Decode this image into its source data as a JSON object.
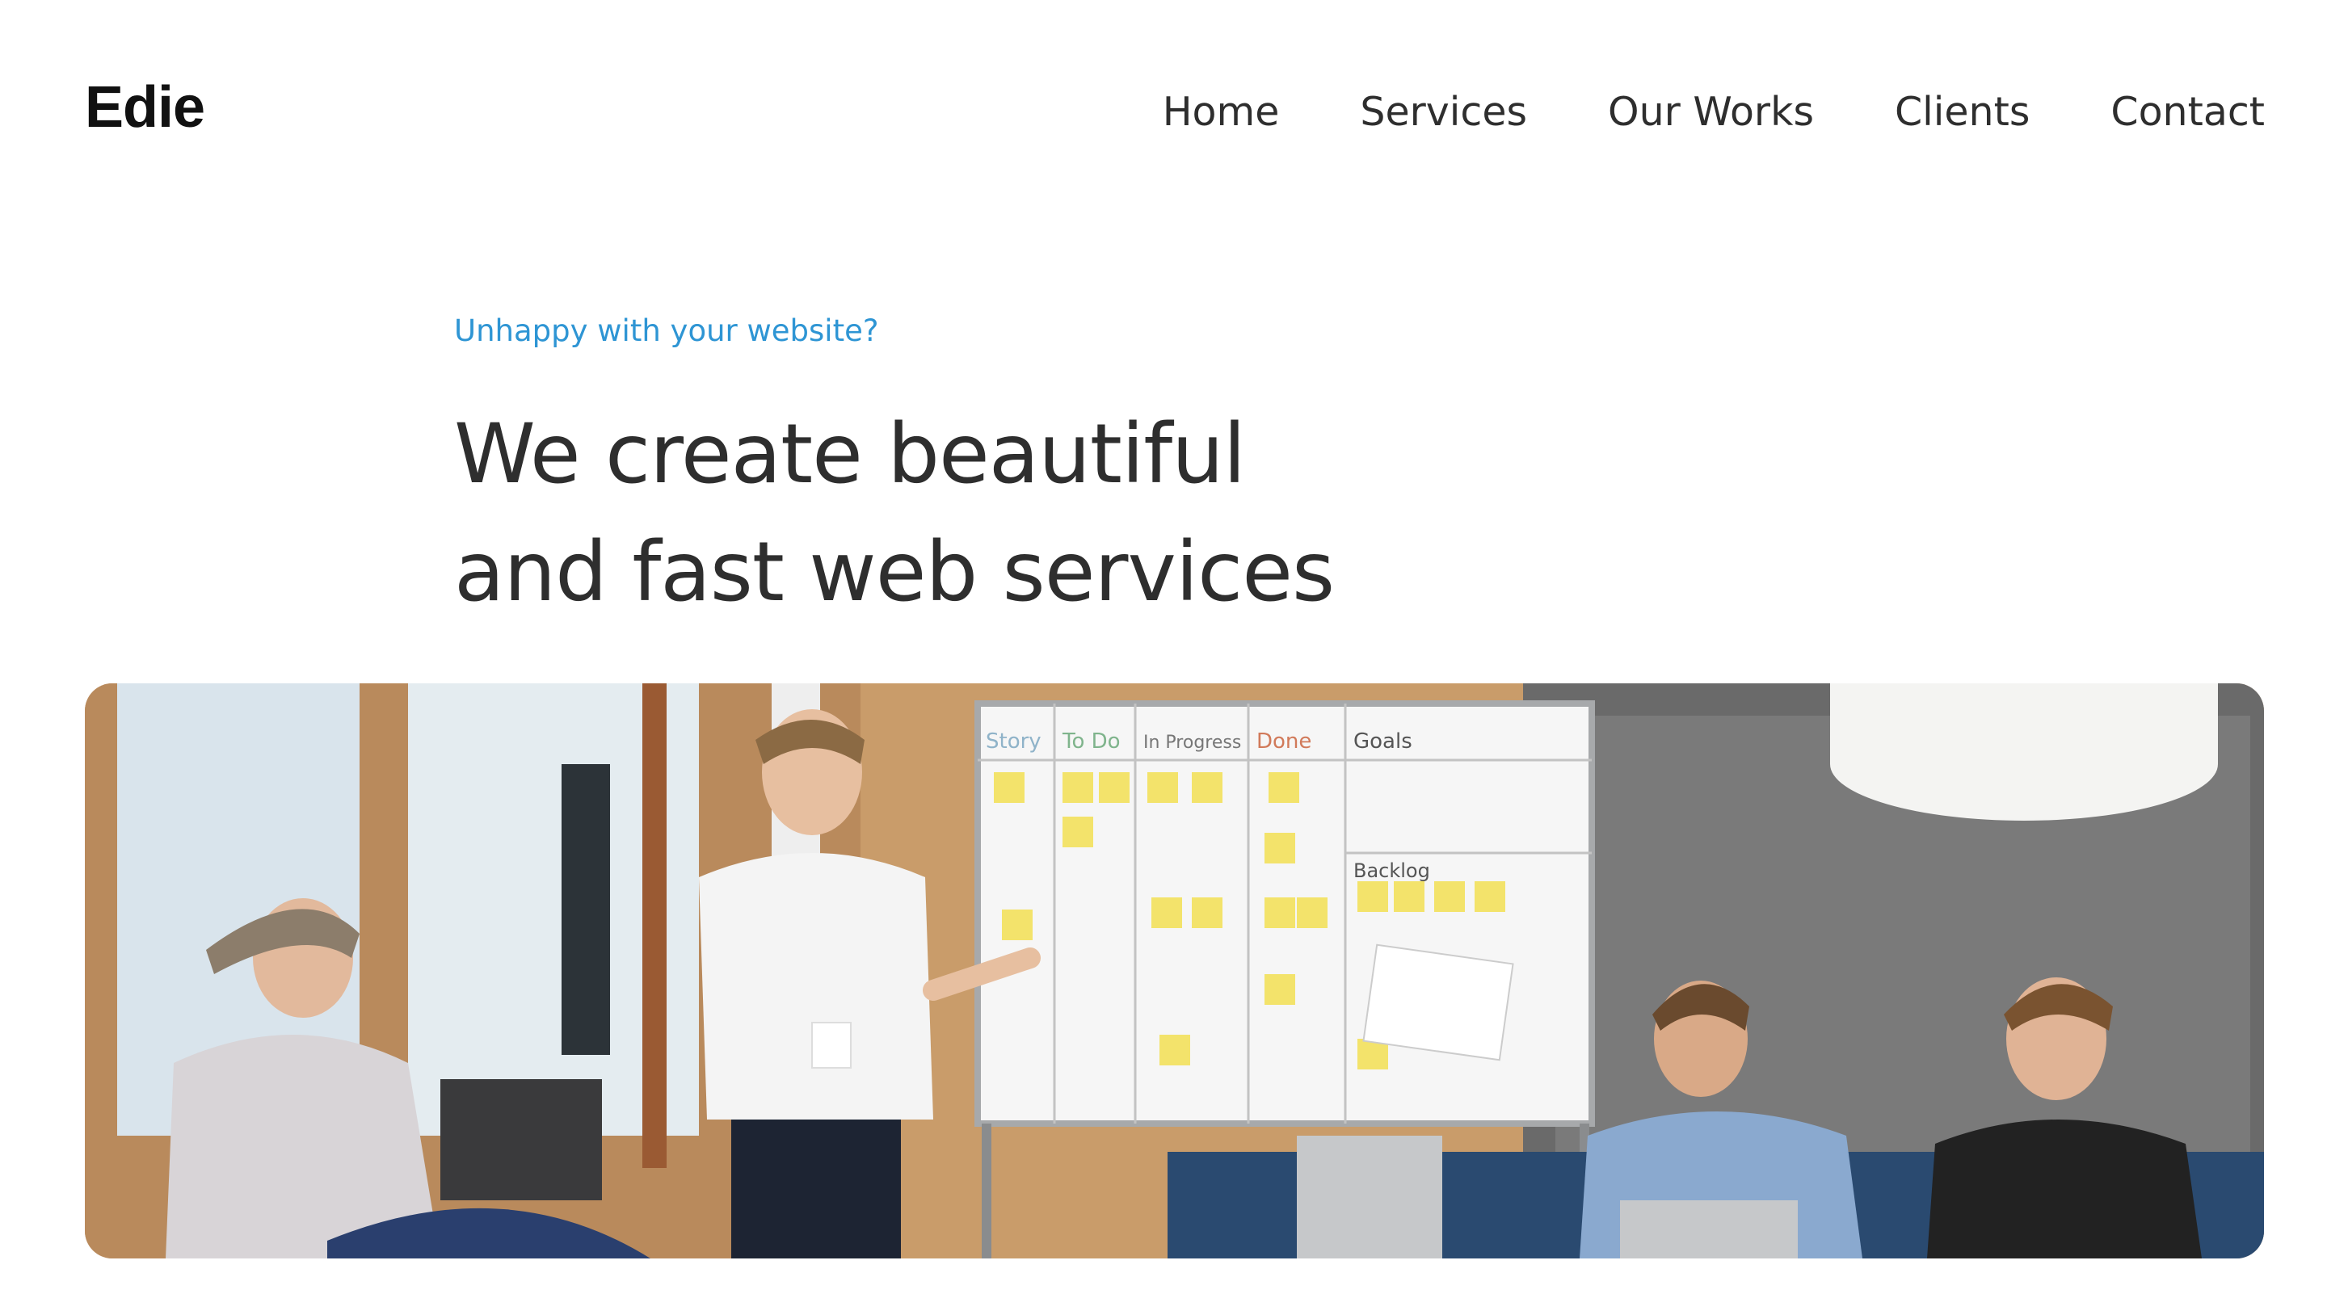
{
  "header": {
    "logo": "Edie",
    "nav": [
      {
        "label": "Home"
      },
      {
        "label": "Services"
      },
      {
        "label": "Our Works"
      },
      {
        "label": "Clients"
      },
      {
        "label": "Contact"
      }
    ]
  },
  "hero": {
    "eyebrow": "Unhappy with your website?",
    "headline_line1": "We create beautiful",
    "headline_line2": "and fast web services"
  },
  "board": {
    "col1": "Story",
    "col2": "To Do",
    "col3": "In Progress",
    "col4": "Done",
    "col5": "Goals",
    "backlog": "Backlog"
  },
  "colors": {
    "accent": "#2e95d4",
    "text": "#2e2e2e",
    "logo": "#111111"
  }
}
